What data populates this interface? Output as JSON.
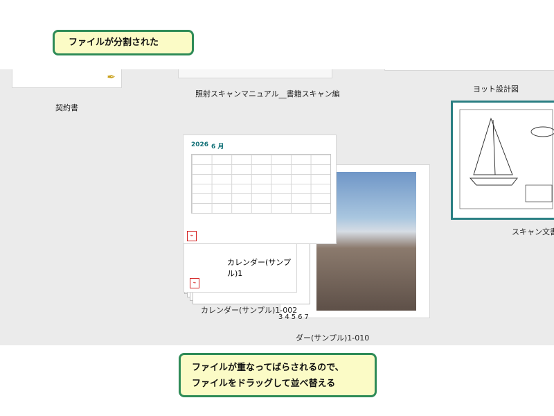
{
  "callouts": {
    "top": "ファイルが分割された",
    "bottom_line1": "ファイルが重なってばらされるので、",
    "bottom_line2": "ファイルをドラッグして並べ替える"
  },
  "files": {
    "contract_label": "契約書",
    "manual_label": "照射スキャンマニュアル__書籍スキャン編",
    "yacht_label": "ヨット設計図",
    "scan_label": "スキャン文書",
    "calendar_year": "2026",
    "calendar_month": "6 月",
    "calendar_inner_label": "カレンダー(サンプル)1",
    "calendar_label_002": "カレンダー(サンプル)1-002",
    "calendar_label_010": "ダー(サンプル)1-010",
    "overlap_digits": "34567",
    "pdf_icon": "pdf-icon"
  }
}
